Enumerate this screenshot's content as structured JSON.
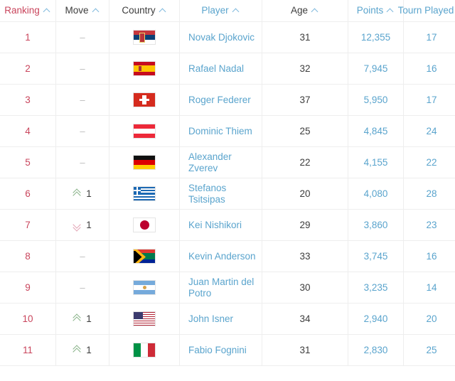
{
  "table": {
    "columns": [
      {
        "label": "Ranking",
        "key": "ranking",
        "sort_icon": "chevron-up-icon"
      },
      {
        "label": "Move",
        "key": "move",
        "sort_icon": "chevron-up-icon"
      },
      {
        "label": "Country",
        "key": "country",
        "sort_icon": "chevron-up-icon"
      },
      {
        "label": "Player",
        "key": "player",
        "sort_icon": "chevron-up-icon"
      },
      {
        "label": "Age",
        "key": "age",
        "sort_icon": "chevron-up-icon"
      },
      {
        "label": "Points",
        "key": "points",
        "sort_icon": "chevron-up-icon"
      },
      {
        "label": "Tourn Played",
        "key": "tourn_played",
        "sort_icon": "chevron-up-icon"
      }
    ],
    "colors": {
      "ranking_text": "#c9455c",
      "player_text": "#5aa4cd",
      "points_text": "#5aa4cd",
      "tourn_text": "#5aa4cd",
      "age_text": "#3c3c3c",
      "header_text": "#3c3c3c",
      "sort_chevron": "#7fb9dd",
      "move_up": "#86b186",
      "move_down": "#e2a3b4",
      "move_none": "#b9b9b9",
      "border": "#eeeeee",
      "background": "#ffffff"
    },
    "rows": [
      {
        "ranking": "1",
        "move_type": "none",
        "move_value": "–",
        "country": "Serbia",
        "flag": "flag-rs",
        "player": "Novak Djokovic",
        "age": "31",
        "points": "12,355",
        "tourn_played": "17"
      },
      {
        "ranking": "2",
        "move_type": "none",
        "move_value": "–",
        "country": "Spain",
        "flag": "flag-es",
        "player": "Rafael Nadal",
        "age": "32",
        "points": "7,945",
        "tourn_played": "16"
      },
      {
        "ranking": "3",
        "move_type": "none",
        "move_value": "–",
        "country": "Switzerland",
        "flag": "flag-ch",
        "player": "Roger Federer",
        "age": "37",
        "points": "5,950",
        "tourn_played": "17"
      },
      {
        "ranking": "4",
        "move_type": "none",
        "move_value": "–",
        "country": "Austria",
        "flag": "flag-at",
        "player": "Dominic Thiem",
        "age": "25",
        "points": "4,845",
        "tourn_played": "24"
      },
      {
        "ranking": "5",
        "move_type": "none",
        "move_value": "–",
        "country": "Germany",
        "flag": "flag-de",
        "player": "Alexander Zverev",
        "age": "22",
        "points": "4,155",
        "tourn_played": "22"
      },
      {
        "ranking": "6",
        "move_type": "up",
        "move_value": "1",
        "country": "Greece",
        "flag": "flag-gr",
        "player": "Stefanos Tsitsipas",
        "age": "20",
        "points": "4,080",
        "tourn_played": "28"
      },
      {
        "ranking": "7",
        "move_type": "down",
        "move_value": "1",
        "country": "Japan",
        "flag": "flag-jp",
        "player": "Kei Nishikori",
        "age": "29",
        "points": "3,860",
        "tourn_played": "23"
      },
      {
        "ranking": "8",
        "move_type": "none",
        "move_value": "–",
        "country": "South Africa",
        "flag": "flag-za",
        "player": "Kevin Anderson",
        "age": "33",
        "points": "3,745",
        "tourn_played": "16"
      },
      {
        "ranking": "9",
        "move_type": "none",
        "move_value": "–",
        "country": "Argentina",
        "flag": "flag-ar",
        "player": "Juan Martin del Potro",
        "age": "30",
        "points": "3,235",
        "tourn_played": "14"
      },
      {
        "ranking": "10",
        "move_type": "up",
        "move_value": "1",
        "country": "United States",
        "flag": "flag-us",
        "player": "John Isner",
        "age": "34",
        "points": "2,940",
        "tourn_played": "20"
      },
      {
        "ranking": "11",
        "move_type": "up",
        "move_value": "1",
        "country": "Italy",
        "flag": "flag-it",
        "player": "Fabio Fognini",
        "age": "31",
        "points": "2,830",
        "tourn_played": "25"
      }
    ]
  }
}
